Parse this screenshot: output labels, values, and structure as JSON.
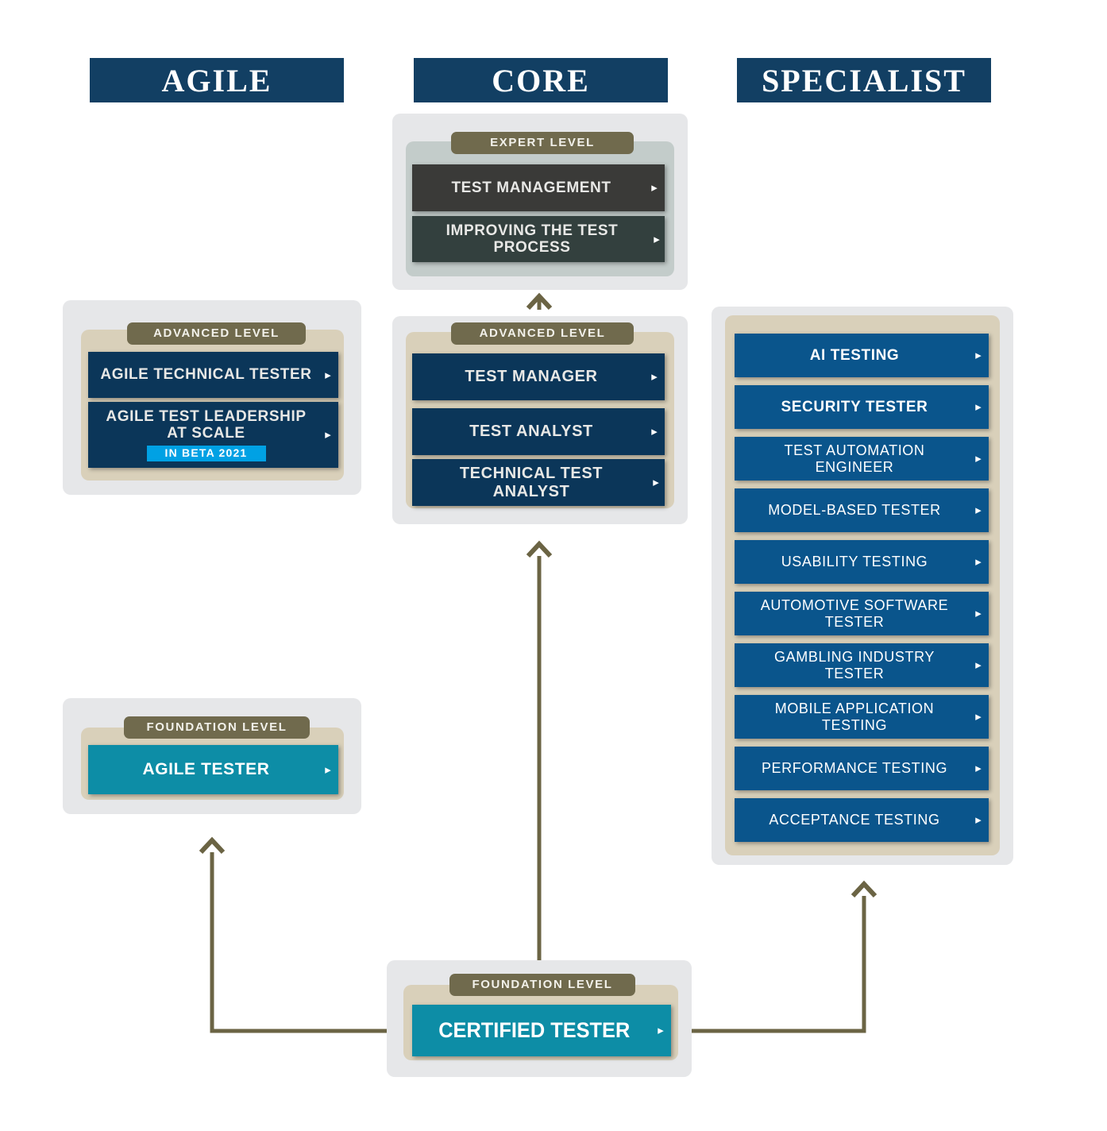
{
  "columns": [
    {
      "id": "agile",
      "title": "AGILE"
    },
    {
      "id": "core",
      "title": "CORE"
    },
    {
      "id": "specialist",
      "title": "SPECIALIST"
    }
  ],
  "levels": {
    "expert": "EXPERT LEVEL",
    "advanced": "ADVANCED LEVEL",
    "foundation": "FOUNDATION LEVEL"
  },
  "core": {
    "expert": [
      {
        "label": "TEST MANAGEMENT",
        "arrow": "▸"
      },
      {
        "label": "IMPROVING THE TEST PROCESS",
        "arrow": "▸"
      }
    ],
    "advanced": [
      {
        "label": "TEST MANAGER",
        "arrow": "▸"
      },
      {
        "label": "TEST ANALYST",
        "arrow": "▸"
      },
      {
        "label": "TECHNICAL TEST ANALYST",
        "arrow": "▸"
      }
    ],
    "foundation": [
      {
        "label": "CERTIFIED TESTER",
        "arrow": "▸"
      }
    ]
  },
  "agile": {
    "advanced": [
      {
        "label": "AGILE TECHNICAL TESTER",
        "arrow": "▸",
        "badge": null
      },
      {
        "label": "AGILE TEST LEADERSHIP AT SCALE",
        "arrow": "▸",
        "badge": "IN BETA 2021"
      }
    ],
    "foundation": [
      {
        "label": "AGILE TESTER",
        "arrow": "▸"
      }
    ]
  },
  "specialist": {
    "cards": [
      {
        "label": "AI TESTING",
        "arrow": "▸"
      },
      {
        "label": "SECURITY TESTER",
        "arrow": "▸"
      },
      {
        "label": "TEST AUTOMATION ENGINEER",
        "arrow": "▸"
      },
      {
        "label": "MODEL-BASED TESTER",
        "arrow": "▸"
      },
      {
        "label": "USABILITY TESTING",
        "arrow": "▸"
      },
      {
        "label": "AUTOMOTIVE SOFTWARE TESTER",
        "arrow": "▸"
      },
      {
        "label": "GAMBLING INDUSTRY TESTER",
        "arrow": "▸"
      },
      {
        "label": "MOBILE APPLICATION TESTING",
        "arrow": "▸"
      },
      {
        "label": "PERFORMANCE TESTING",
        "arrow": "▸"
      },
      {
        "label": "ACCEPTANCE TESTING",
        "arrow": "▸"
      }
    ]
  },
  "colors": {
    "header_navy": "#123f63",
    "advanced_navy": "#0b3659",
    "specialist_blue": "#0a558c",
    "foundation_teal": "#0d8da6",
    "expert_dark": "#3a3a38",
    "expert_dark_alt": "#33403e",
    "level_pill_olive": "#706a4d",
    "panel_tan": "#d9d0ba",
    "panel_sage": "#c3ccca",
    "group_gray": "#e6e7e9",
    "beta_badge_cyan": "#00a1e4",
    "connector_olive": "#6b6444"
  }
}
